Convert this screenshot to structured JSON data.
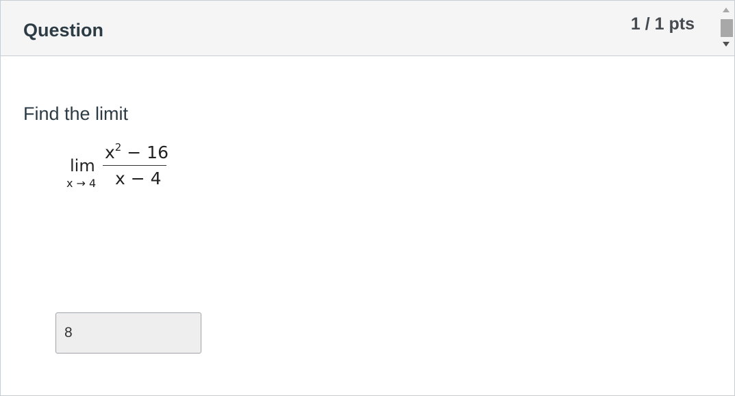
{
  "header": {
    "title": "Question",
    "points": "1 / 1 pts"
  },
  "scrollbar": {
    "up_icon": "arrow-up-icon",
    "down_icon": "arrow-down-icon"
  },
  "question": {
    "prompt": "Find the limit",
    "math": {
      "operator": "lim",
      "subscript": "x → 4",
      "numerator_base": "x",
      "numerator_exponent": "2",
      "numerator_rest": " − 16",
      "denominator": "x − 4"
    }
  },
  "answer": {
    "value": "8"
  },
  "colors": {
    "header_bg": "#f5f5f5",
    "text": "#2d3b45",
    "input_bg": "#eeeeee"
  }
}
